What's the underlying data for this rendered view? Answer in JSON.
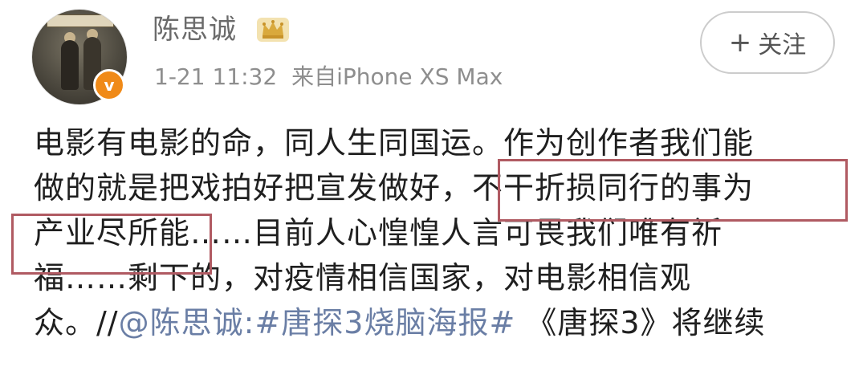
{
  "profile": {
    "username": "陈思诚",
    "verified_badge": "v",
    "avatar_icon": "avatar-movie-poster",
    "badge_icon": "crown-icon",
    "badge_color": "#f08a18"
  },
  "meta": {
    "timestamp": "1-21 11:32",
    "source": "来自iPhone XS Max"
  },
  "follow_button": {
    "plus": "+",
    "label": "关注"
  },
  "post": {
    "line1": "电影有电影的命，同人生同国运。作为创作者我们能",
    "line2_a": "做的就是把戏拍好把宣发做好，",
    "line2_b": "不干折损同行的事为",
    "line3_a": "产业尽所能",
    "line3_b": "……目前人心惶惶人言可畏我们唯有祈",
    "line4": "福……剩下的，对疫情相信国家，对电影相信观",
    "line5_a": "众。//",
    "line5_mention": "@陈思诚",
    "line5_b": ":",
    "line5_hashtag": "#唐探3烧脑海报#",
    "line5_c": " 《唐探3》将继续"
  },
  "colors": {
    "highlight_border": "#b05a62",
    "link": "#6a7ea5",
    "text": "#1f1f1f",
    "meta": "#8e8e8e"
  }
}
